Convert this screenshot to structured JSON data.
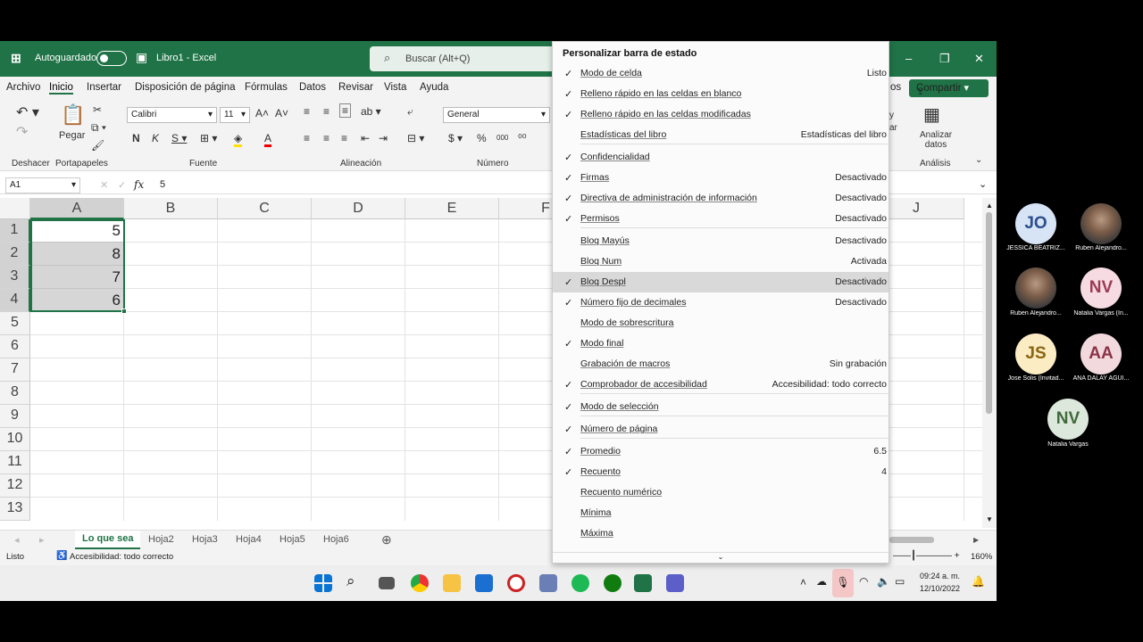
{
  "titlebar": {
    "autosave": "Autoguardado",
    "doc": "Libro1  -  Excel",
    "search": "Buscar (Alt+Q)"
  },
  "menubar": {
    "items": [
      "Archivo",
      "Inicio",
      "Insertar",
      "Disposición de página",
      "Fórmulas",
      "Datos",
      "Revisar",
      "Vista",
      "Ayuda"
    ],
    "tail": "os",
    "share": "Compartir"
  },
  "ribbon": {
    "groups": [
      "Deshacer",
      "Portapapeles",
      "Fuente",
      "Alineación",
      "Número",
      "Análisis"
    ],
    "paste": "Pegar",
    "font": "Calibri",
    "size": "11",
    "format": "General",
    "analyze": "Analizar datos",
    "partial": "ar",
    "partial2": "y"
  },
  "formula": {
    "namebox": "A1",
    "fx": "fx",
    "value": "5"
  },
  "grid": {
    "columns": [
      "A",
      "B",
      "C",
      "D",
      "E",
      "F",
      "J"
    ],
    "rows": [
      "1",
      "2",
      "3",
      "4",
      "5",
      "6",
      "7",
      "8",
      "9",
      "10",
      "11",
      "12",
      "13"
    ],
    "values": [
      "5",
      "8",
      "7",
      "6"
    ]
  },
  "sheets": [
    "Lo que sea",
    "Hoja2",
    "Hoja3",
    "Hoja4",
    "Hoja5",
    "Hoja6"
  ],
  "status": {
    "left": "Listo",
    "access": "Accesibilidad: todo correcto",
    "zoom": "160%"
  },
  "menu": {
    "title": "Personalizar barra de estado",
    "items": [
      {
        "check": "✓",
        "label": "Modo de celda",
        "value": "Listo"
      },
      {
        "check": "✓",
        "label": "Relleno rápido en las celdas en blanco",
        "value": ""
      },
      {
        "check": "✓",
        "label": "Relleno rápido en las celdas modificadas",
        "value": ""
      },
      {
        "check": "",
        "label": "Estadísticas del libro",
        "value": "Estadísticas del libro"
      },
      {
        "check": "✓",
        "label": "Confidencialidad",
        "value": ""
      },
      {
        "check": "✓",
        "label": "Firmas",
        "value": "Desactivado"
      },
      {
        "check": "✓",
        "label": "Directiva de administración de información",
        "value": "Desactivado"
      },
      {
        "check": "✓",
        "label": "Permisos",
        "value": "Desactivado"
      },
      {
        "check": "",
        "label": "Bloq Mayús",
        "value": "Desactivado"
      },
      {
        "check": "",
        "label": "Bloq Num",
        "value": "Activada"
      },
      {
        "check": "✓",
        "label": "Bloq Despl",
        "value": "Desactivado"
      },
      {
        "check": "✓",
        "label": "Número fijo de decimales",
        "value": "Desactivado"
      },
      {
        "check": "",
        "label": "Modo de sobrescritura",
        "value": ""
      },
      {
        "check": "✓",
        "label": "Modo final",
        "value": ""
      },
      {
        "check": "",
        "label": "Grabación de macros",
        "value": "Sin grabación"
      },
      {
        "check": "✓",
        "label": "Comprobador de accesibilidad",
        "value": "Accesibilidad: todo correcto"
      },
      {
        "check": "✓",
        "label": "Modo de selección",
        "value": ""
      },
      {
        "check": "✓",
        "label": "Número de página",
        "value": ""
      },
      {
        "check": "✓",
        "label": "Promedio",
        "value": "6.5"
      },
      {
        "check": "✓",
        "label": "Recuento",
        "value": "4"
      },
      {
        "check": "",
        "label": "Recuento numérico",
        "value": ""
      },
      {
        "check": "",
        "label": "Mínima",
        "value": ""
      },
      {
        "check": "",
        "label": "Máxima",
        "value": ""
      }
    ]
  },
  "participants": [
    {
      "initials": "JO",
      "name": "JESSICA BEATRIZ...",
      "color": "#d6e4f5",
      "text": "#2b4e8c"
    },
    {
      "initials": "",
      "name": "Ruben Alejandro...",
      "color": "",
      "text": ""
    },
    {
      "initials": "",
      "name": "Ruben Alejandro...",
      "color": "",
      "text": ""
    },
    {
      "initials": "NV",
      "name": "Natalia Vargas (In...",
      "color": "#f7dbe2",
      "text": "#9c3a55"
    },
    {
      "initials": "JS",
      "name": "Jose Solis (Invitad...",
      "color": "#fbecc4",
      "text": "#8a6410"
    },
    {
      "initials": "AA",
      "name": "ANA DALAY AGUI...",
      "color": "#f1d9dd",
      "text": "#8c3347"
    },
    {
      "initials": "NV",
      "name": "Natalia Vargas",
      "color": "#dde8dc",
      "text": "#3f6b3a"
    }
  ],
  "clock": {
    "time": "09:24 a. m.",
    "date": "12/10/2022"
  }
}
